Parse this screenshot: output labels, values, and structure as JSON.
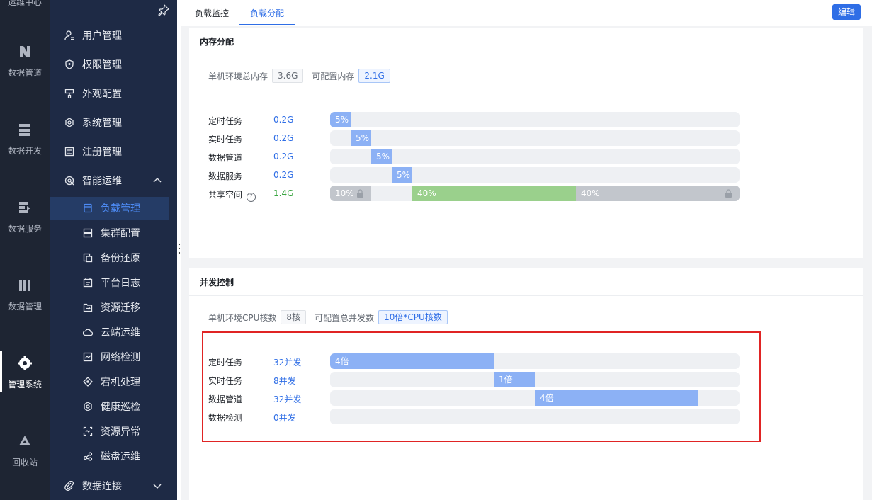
{
  "rail": {
    "top_label": "运维中心",
    "items": [
      {
        "label": "数据管道",
        "icon": "pipeline-icon"
      },
      {
        "label": "数据开发",
        "icon": "server-icon"
      },
      {
        "label": "数据服务",
        "icon": "service-icon"
      },
      {
        "label": "数据管理",
        "icon": "library-icon"
      },
      {
        "label": "管理系统",
        "icon": "gear-icon",
        "active": true
      },
      {
        "label": "回收站",
        "icon": "recycle-icon"
      }
    ]
  },
  "menu": {
    "items": [
      {
        "label": "用户管理",
        "icon": "user-icon"
      },
      {
        "label": "权限管理",
        "icon": "shield-icon"
      },
      {
        "label": "外观配置",
        "icon": "brush-icon"
      },
      {
        "label": "系统管理",
        "icon": "settings-icon"
      },
      {
        "label": "注册管理",
        "icon": "register-icon"
      },
      {
        "label": "智能运维",
        "icon": "ops-icon",
        "expanded": true
      },
      {
        "label": "负载管理",
        "icon": "load-icon",
        "selected": true
      },
      {
        "label": "集群配置",
        "icon": "cluster-icon"
      },
      {
        "label": "备份还原",
        "icon": "backup-icon"
      },
      {
        "label": "平台日志",
        "icon": "log-icon"
      },
      {
        "label": "资源迁移",
        "icon": "migrate-icon"
      },
      {
        "label": "云端运维",
        "icon": "cloud-icon"
      },
      {
        "label": "网络检测",
        "icon": "network-icon"
      },
      {
        "label": "宕机处理",
        "icon": "down-icon"
      },
      {
        "label": "健康巡检",
        "icon": "health-icon"
      },
      {
        "label": "资源异常",
        "icon": "anomaly-icon"
      },
      {
        "label": "磁盘运维",
        "icon": "disk-icon"
      },
      {
        "label": "数据连接",
        "icon": "link-icon",
        "collapsed": true
      }
    ]
  },
  "tabs": [
    {
      "label": "负载监控"
    },
    {
      "label": "负载分配",
      "active": true
    }
  ],
  "edit_button": "编辑",
  "memory": {
    "title": "内存分配",
    "total_label": "单机环境总内存",
    "total_value": "3.6G",
    "config_label": "可配置内存",
    "config_value": "2.1G",
    "rows": [
      {
        "label": "定时任务",
        "value": "0.2G",
        "bar_label": "5%"
      },
      {
        "label": "实时任务",
        "value": "0.2G",
        "bar_label": "5%"
      },
      {
        "label": "数据管道",
        "value": "0.2G",
        "bar_label": "5%"
      },
      {
        "label": "数据服务",
        "value": "0.2G",
        "bar_label": "5%"
      }
    ],
    "shared": {
      "label": "共享空间",
      "help": "?",
      "value": "1.4G",
      "seg1": "10%",
      "seg2": "40%",
      "seg3": "40%"
    }
  },
  "concurrency": {
    "title": "并发控制",
    "cpu_label": "单机环境CPU核数",
    "cpu_value": "8核",
    "total_label": "可配置总并发数",
    "total_value": "10倍*CPU核数",
    "rows": [
      {
        "label": "定时任务",
        "value": "32并发",
        "bar_label": "4倍"
      },
      {
        "label": "实时任务",
        "value": "8并发",
        "bar_label": "1倍"
      },
      {
        "label": "数据管道",
        "value": "32并发",
        "bar_label": "4倍"
      },
      {
        "label": "数据检测",
        "value": "0并发",
        "bar_label": ""
      }
    ]
  },
  "colors": {
    "accent": "#2f6ee6",
    "bar_blue": "#8cb1f5",
    "bar_green": "#9ad08c",
    "bar_grey": "#c2c6cc",
    "highlight": "#e02424"
  }
}
